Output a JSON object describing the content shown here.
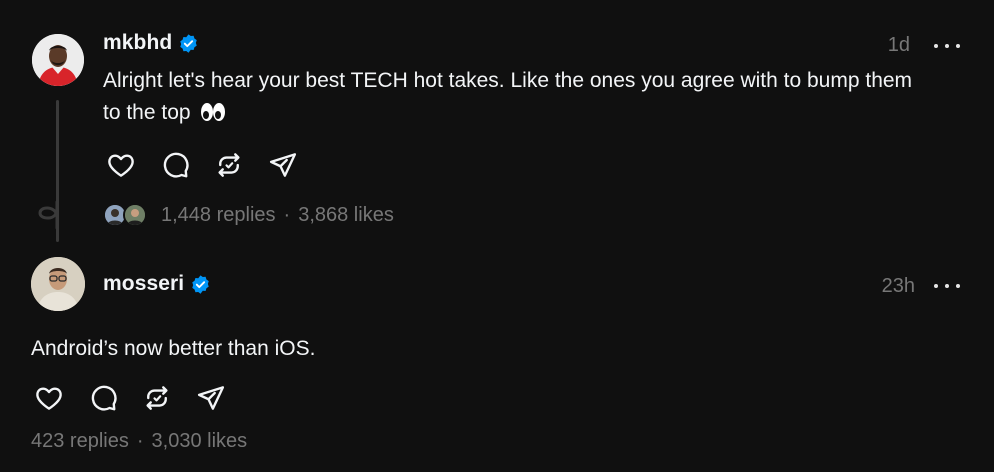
{
  "posts": [
    {
      "author": "mkbhd",
      "verified": true,
      "time": "1d",
      "text": "Alright let's hear your best TECH hot takes. Like the ones you agree with to bump them to the top",
      "replies": "1,448 replies",
      "likes": "3,868 likes",
      "separator": "·"
    },
    {
      "author": "mosseri",
      "verified": true,
      "time": "23h",
      "text": "Android’s now better than iOS.",
      "replies": "423 replies",
      "likes": "3,030 likes",
      "separator": "·"
    }
  ],
  "icons": {
    "like": "heart-icon",
    "reply": "comment-icon",
    "repost": "repost-icon",
    "share": "send-icon",
    "more": "more-icon",
    "verified": "verified-badge-icon"
  },
  "colors": {
    "background": "#101010",
    "text_primary": "#f3f5f7",
    "text_secondary": "#777777",
    "verified_blue": "#0095f6"
  }
}
